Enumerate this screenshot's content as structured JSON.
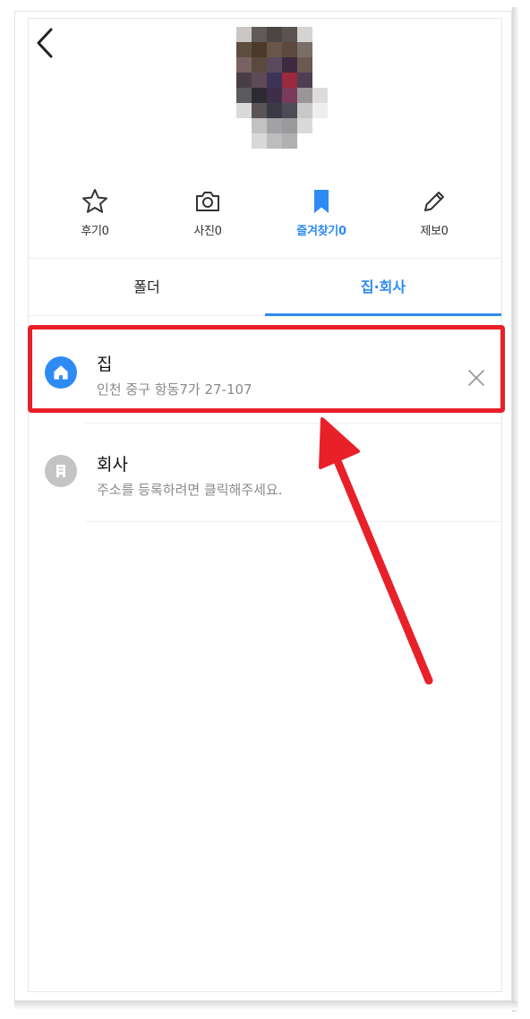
{
  "header": {
    "back_icon": "chevron-left-icon"
  },
  "profile": {
    "avatar": "pixelated-avatar"
  },
  "actions": [
    {
      "label": "후기",
      "count": "0",
      "icon": "star-icon",
      "active": false
    },
    {
      "label": "사진",
      "count": "0",
      "icon": "camera-icon",
      "active": false
    },
    {
      "label": "즐겨찾기",
      "count": "0",
      "icon": "bookmark-icon",
      "active": true
    },
    {
      "label": "제보",
      "count": "0",
      "icon": "pencil-icon",
      "active": false
    }
  ],
  "tabs": [
    {
      "label": "폴더",
      "active": false
    },
    {
      "label": "집·회사",
      "active": true
    }
  ],
  "places": [
    {
      "title": "집",
      "subtitle": "인천 중구 항동7가 27-107",
      "icon": "home-icon",
      "icon_color": "#2e8bf4",
      "has_delete": true
    },
    {
      "title": "회사",
      "subtitle": "주소를 등록하려면 클릭해주세요.",
      "icon": "building-icon",
      "icon_color": "#c4c4c4",
      "has_delete": false
    }
  ],
  "colors": {
    "accent": "#2e8bf4",
    "highlight": "#e8202a"
  }
}
